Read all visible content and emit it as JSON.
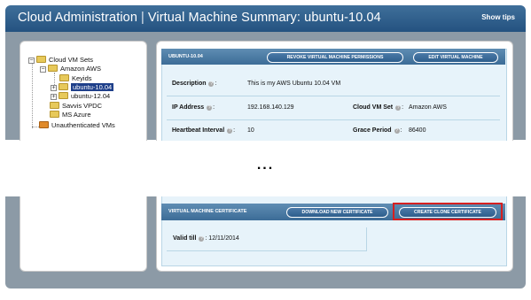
{
  "header": {
    "title_app": "Cloud Administration",
    "title_page": "Virtual Machine Summary: ubuntu-10.04",
    "show_tips": "Show tips"
  },
  "tree": {
    "root": "Cloud VM Sets",
    "amazon": "Amazon AWS",
    "keyids": "Keyids",
    "ubuntu1004": "ubuntu-10.04",
    "ubuntu1204": "ubuntu-12.04",
    "savvis": "Savvis VPDC",
    "azure": "MS Azure",
    "unauth": "Unauthenticated VMs"
  },
  "vm_card": {
    "heading": "UBUNTU-10.04",
    "revoke_label": "REVOKE VIRTUAL MACHINE PERMISSIONS",
    "edit_label": "EDIT VIRTUAL MACHINE",
    "description_label": "Description",
    "description_value": "This is my AWS Ubuntu 10.04 VM",
    "ip_label": "IP Address",
    "ip_value": "192.168.140.129",
    "vmset_label": "Cloud VM Set",
    "vmset_value": "Amazon AWS",
    "heartbeat_label": "Heartbeat Interval",
    "heartbeat_value": "10",
    "grace_label": "Grace Period",
    "grace_value": "86400"
  },
  "ellipsis": "...",
  "cert_card": {
    "heading": "VIRTUAL MACHINE CERTIFICATE",
    "download_label": "DOWNLOAD NEW CERTIFICATE",
    "clone_label": "CREATE CLONE CERTIFICATE",
    "valid_label": "Valid till",
    "valid_value": "12/11/2014"
  },
  "colors": {
    "header": "#2f5f8c",
    "highlight": "#d62020",
    "card_bg": "#e7f3fa"
  }
}
